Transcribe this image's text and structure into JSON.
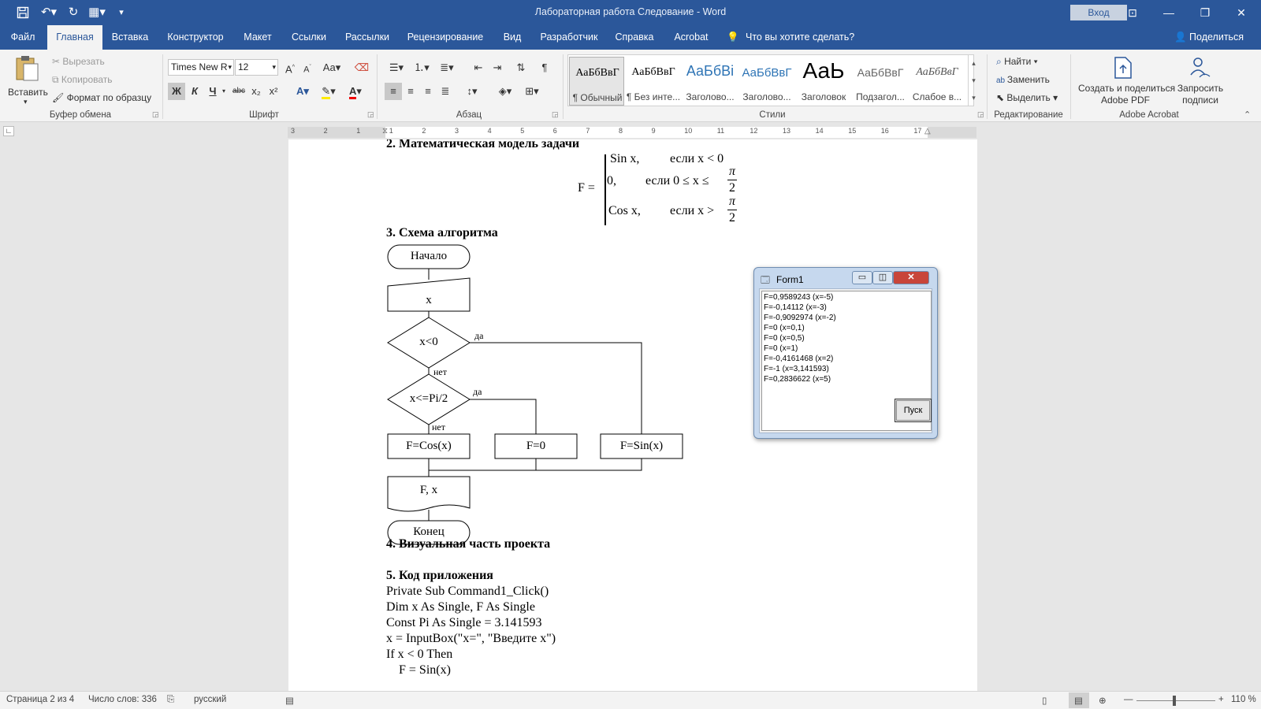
{
  "window": {
    "title": "Лабораторная работа Следование  -  Word",
    "sign_in": "Вход"
  },
  "tabs": [
    {
      "label": "Файл"
    },
    {
      "label": "Главная"
    },
    {
      "label": "Вставка"
    },
    {
      "label": "Конструктор"
    },
    {
      "label": "Макет"
    },
    {
      "label": "Ссылки"
    },
    {
      "label": "Рассылки"
    },
    {
      "label": "Рецензирование"
    },
    {
      "label": "Вид"
    },
    {
      "label": "Разработчик"
    },
    {
      "label": "Справка"
    },
    {
      "label": "Acrobat"
    }
  ],
  "tell_me": "Что вы хотите сделать?",
  "share": "Поделиться",
  "ribbon": {
    "clipboard": {
      "paste": "Вставить",
      "cut": "Вырезать",
      "copy": "Копировать",
      "format_painter": "Формат по образцу",
      "label": "Буфер обмена"
    },
    "font": {
      "family": "Times New R",
      "size": "12",
      "label": "Шрифт",
      "bold": "Ж",
      "italic": "К",
      "underline": "Ч",
      "strike": "abc",
      "sub": "x₂",
      "sup": "x²",
      "case": "Aa"
    },
    "paragraph": {
      "label": "Абзац"
    },
    "styles": {
      "label": "Стили",
      "items": [
        {
          "sample": "АаБбВвГ",
          "name": "¶ Обычный"
        },
        {
          "sample": "АаБбВвГ",
          "name": "¶ Без инте..."
        },
        {
          "sample": "АаБбВі",
          "name": "Заголово..."
        },
        {
          "sample": "АаБбВвГ",
          "name": "Заголово..."
        },
        {
          "sample": "АаЬ",
          "name": "Заголовок"
        },
        {
          "sample": "АаБбВвГ",
          "name": "Подзагол..."
        },
        {
          "sample": "АаБбВвГ",
          "name": "Слабое в..."
        }
      ]
    },
    "editing": {
      "label": "Редактирование",
      "find": "Найти",
      "replace": "Заменить",
      "select": "Выделить"
    },
    "acrobat": {
      "label": "Adobe Acrobat",
      "create_share_1": "Создать и поделиться",
      "create_share_2": "Adobe PDF",
      "request_1": "Запросить",
      "request_2": "подписи"
    }
  },
  "ruler_ticks": [
    "3",
    "2",
    "1",
    "1",
    "2",
    "3",
    "4",
    "5",
    "6",
    "7",
    "8",
    "9",
    "10",
    "11",
    "12",
    "13",
    "14",
    "15",
    "16",
    "17"
  ],
  "document": {
    "h2": "2.   Математическая модель задачи",
    "formula": {
      "lhs": "F =",
      "row1_val": "Sin x,",
      "row1_cond": "если x < 0",
      "row2_val": "0,",
      "row2_cond": "если 0 ≤ x ≤",
      "row3_val": "Cos x,",
      "row3_cond": "если x >",
      "pi": "π",
      "two": "2"
    },
    "h3": "3.   Схема алгоритма",
    "flowchart": {
      "start": "Начало",
      "input": "x",
      "cond1": "x<0",
      "yes1": "да",
      "no1": "нет",
      "cond2": "x<=Pi/2",
      "yes2": "да",
      "no2": "нет",
      "box_cos": "F=Cos(x)",
      "box_zero": "F=0",
      "box_sin": "F=Sin(x)",
      "output": "F, x",
      "end": "Конец"
    },
    "h4": "4.   Визуальная часть проекта",
    "h5": "5.   Код приложения",
    "code": [
      "Private Sub Command1_Click()",
      "Dim x As Single, F As Single",
      "Const Pi As Single = 3.141593",
      "x = InputBox(\"x=\", \"Введите x\")",
      "If x < 0 Then",
      "    F = Sin(x)"
    ]
  },
  "form1": {
    "title": "Form1",
    "lines": [
      "F=0,9589243 (x=-5)",
      "F=-0,14112 (x=-3)",
      "F=-0,9092974 (x=-2)",
      "F=0 (x=0,1)",
      "F=0 (x=0,5)",
      "F=0 (x=1)",
      "F=-0,4161468 (x=2)",
      "F=-1 (x=3,141593)",
      "F=0,2836622 (x=5)"
    ],
    "button": "Пуск"
  },
  "status": {
    "page": "Страница 2 из 4",
    "words": "Число слов: 336",
    "language": "русский",
    "zoom": "110 %"
  }
}
